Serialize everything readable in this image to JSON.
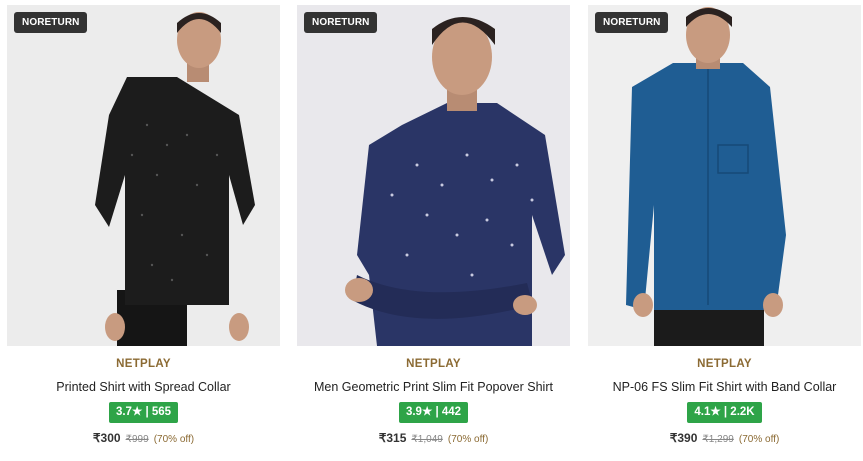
{
  "products": [
    {
      "badge": "NORETURN",
      "brand": "NETPLAY",
      "name": "Printed Shirt with Spread Collar",
      "rating": "3.7★ | 565",
      "price": "₹300",
      "mrp": "₹999",
      "discount": "(70% off)",
      "shirt_color": "#1c1c1c",
      "bg_color": "#ececec"
    },
    {
      "badge": "NORETURN",
      "brand": "NETPLAY",
      "name": "Men Geometric Print Slim Fit Popover Shirt",
      "rating": "3.9★ | 442",
      "price": "₹315",
      "mrp": "₹1,049",
      "discount": "(70% off)",
      "shirt_color": "#2a3566",
      "bg_color": "#e9e8ec"
    },
    {
      "badge": "NORETURN",
      "brand": "NETPLAY",
      "name": "NP-06 FS Slim Fit Shirt with Band Collar",
      "rating": "4.1★ | 2.2K",
      "price": "₹390",
      "mrp": "₹1,299",
      "discount": "(70% off)",
      "shirt_color": "#1f5d93",
      "bg_color": "#efefef"
    }
  ],
  "colors": {
    "rating_green": "#2ea448",
    "brand_gold": "#8b6a33",
    "badge_dark": "#333333"
  }
}
